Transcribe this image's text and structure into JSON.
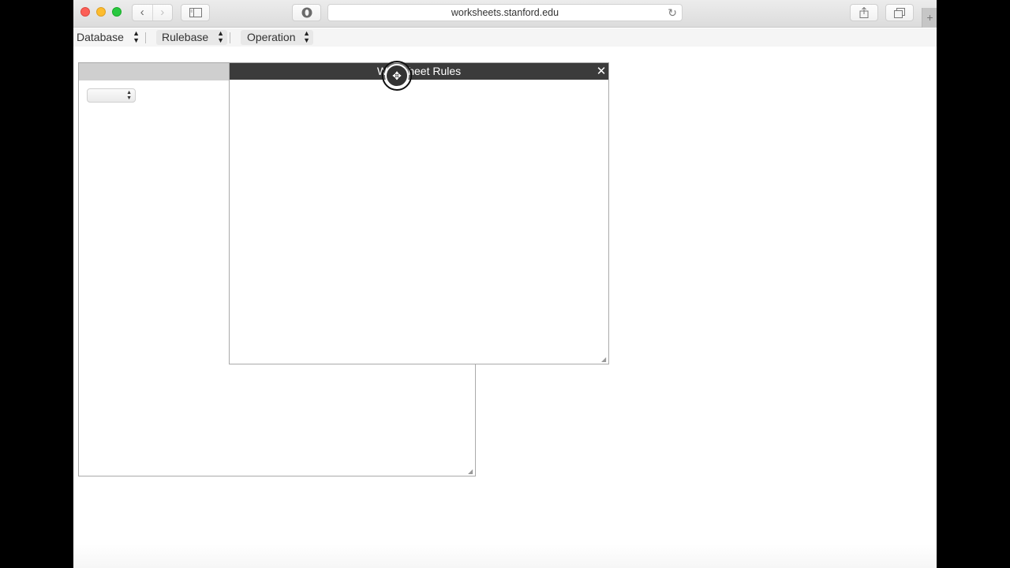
{
  "browser": {
    "address": "worksheets.stanford.edu",
    "nav_back_glyph": "‹",
    "nav_forward_glyph": "›",
    "reload_glyph": "↻",
    "newtab_glyph": "+",
    "icons": [
      "back-icon",
      "forward-icon",
      "sidebar-icon",
      "extension-icon",
      "reload-icon",
      "share-icon",
      "tabs-icon"
    ]
  },
  "menubar": {
    "database": "Database",
    "rulebase": "Rulebase",
    "operation": "Operation"
  },
  "dialog": {
    "title": "Worksheet Rules",
    "close_glyph": "✕"
  },
  "cursor": {
    "glyph": "✥"
  }
}
